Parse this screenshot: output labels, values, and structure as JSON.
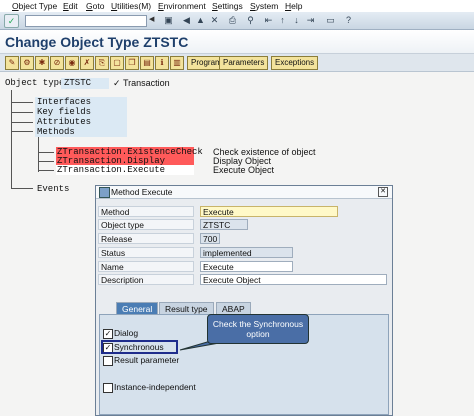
{
  "menu": [
    "Object Type",
    "Edit",
    "Goto",
    "Utilities(M)",
    "Environment",
    "Settings",
    "System",
    "Help"
  ],
  "title": "Change Object Type ZTSTC",
  "app_toolbar": {
    "buttons": [
      "Program",
      "Parameters",
      "Exceptions"
    ]
  },
  "object": {
    "label": "Object type",
    "value": "ZTSTC",
    "description": "Transaction"
  },
  "tree": {
    "nodes": [
      "Interfaces",
      "Key fields",
      "Attributes",
      "Methods"
    ],
    "methods": [
      {
        "name": "ZTransaction.ExistenceCheck",
        "desc": "Check existence of object"
      },
      {
        "name": "ZTransaction.Display",
        "desc": "Display Object"
      },
      {
        "name": "ZTransaction.Execute",
        "desc": "Execute Object"
      }
    ],
    "events": "Events"
  },
  "dialog": {
    "title": "Method Execute",
    "fields": [
      {
        "label": "Method",
        "value": "Execute"
      },
      {
        "label": "Object type",
        "value": "ZTSTC"
      },
      {
        "label": "Release",
        "value": "700"
      },
      {
        "label": "Status",
        "value": "implemented"
      },
      {
        "label": "Name",
        "value": "Execute"
      },
      {
        "label": "Description",
        "value": "Execute Object"
      }
    ],
    "tabs": [
      "General",
      "Result type",
      "ABAP"
    ],
    "checkboxes": [
      {
        "label": "Dialog",
        "checked": true
      },
      {
        "label": "Synchronous",
        "checked": true
      },
      {
        "label": "Result parameter",
        "checked": false
      },
      {
        "label": "Instance-independent",
        "checked": false
      }
    ]
  },
  "callout": "Check the Synchronous option",
  "colors": {
    "title": "#1e3f6b",
    "highlight_red": "#ff5a5a",
    "active_tab": "#4b7db4",
    "callout_bg": "#4a6ea6"
  }
}
